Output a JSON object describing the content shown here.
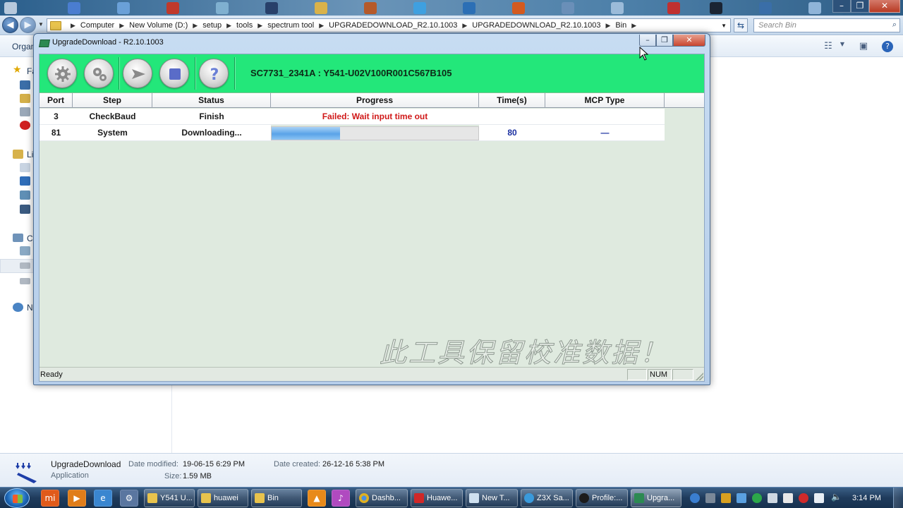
{
  "explorer": {
    "breadcrumb": [
      "Computer",
      "New Volume (D:)",
      "setup",
      "tools",
      "spectrum tool",
      "UPGRADEDOWNLOAD_R2.10.1003",
      "UPGRADEDOWNLOAD_R2.10.1003",
      "Bin"
    ],
    "search_placeholder": "Search Bin",
    "organize_label": "Organ",
    "nav_items": [
      "Fa",
      "Li",
      "C",
      "N"
    ],
    "details": {
      "name": "UpgradeDownload",
      "type": "Application",
      "date_modified_label": "Date modified:",
      "date_modified": "19-06-15 6:29 PM",
      "size_label": "Size:",
      "size": "1.59 MB",
      "date_created_label": "Date created:",
      "date_created": "26-12-16 5:38 PM"
    }
  },
  "app": {
    "title": "UpgradeDownload - R2.10.1003",
    "device_label": "SC7731_2341A : Y541-U02V100R001C567B105",
    "toolbar_icons": [
      "settings-gear-icon",
      "load-packet-gears-icon",
      "start-download-play-icon",
      "stop-download-icon",
      "help-question-icon"
    ],
    "columns": [
      "Port",
      "Step",
      "Status",
      "Progress",
      "Time(s)",
      "MCP Type"
    ],
    "rows": [
      {
        "port": "3",
        "step": "CheckBaud",
        "status": "Finish",
        "progress_text": "Failed: Wait input time out",
        "time": "",
        "mcp": ""
      },
      {
        "port": "81",
        "step": "System",
        "status": "Downloading...",
        "progress_fraction": 0.33,
        "time": "80",
        "mcp": "—"
      }
    ],
    "watermark": "此工具保留校准数据！",
    "status_text": "Ready",
    "status_num": "NUM"
  },
  "taskbar": {
    "items": [
      "Y541 U...",
      "huawei",
      "Bin",
      "Dashb...",
      "Huawe...",
      "New T...",
      "Z3X Sa...",
      "Profile:...",
      "Upgra..."
    ],
    "clock": "3:14 PM"
  },
  "colors": {
    "toolbar_green": "#23e77a",
    "fail_red": "#d01818",
    "time_blue": "#1a2fa0"
  }
}
